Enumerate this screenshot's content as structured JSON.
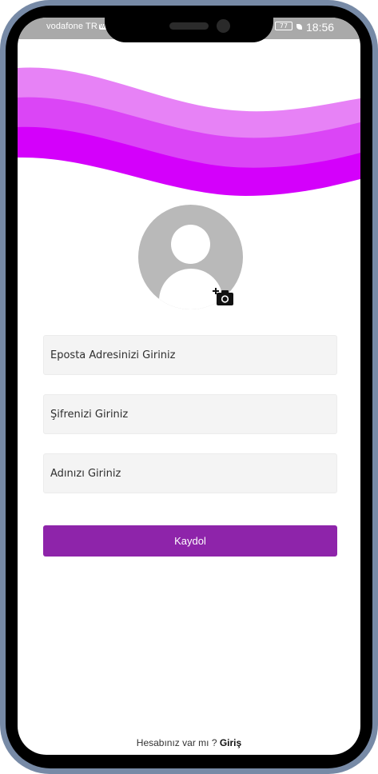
{
  "status_bar": {
    "carrier": "vodafone TR",
    "carrier_badge": "Wi",
    "battery": "77",
    "time": "18:56"
  },
  "colors": {
    "wave_light": "#e782f6",
    "wave_mid": "#db45f6",
    "wave_dark": "#d400fb",
    "button": "#8e24aa",
    "avatar": "#b9b9b9",
    "frame": "#778aa6"
  },
  "avatar": {
    "icon": "person-placeholder-icon",
    "add_icon": "add-a-photo-icon"
  },
  "form": {
    "email_placeholder": "Eposta Adresinizi Giriniz",
    "password_placeholder": "Şifrenizi Giriniz",
    "name_placeholder": "Adınızı Giriniz",
    "register_label": "Kaydol"
  },
  "footer": {
    "prompt": "Hesabınız var mı ?",
    "login_label": "Giriş"
  }
}
